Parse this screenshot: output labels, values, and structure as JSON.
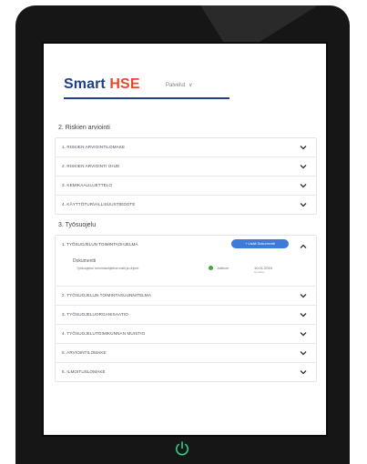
{
  "app": {
    "brand_primary": "Smart",
    "brand_accent": "HSE",
    "menu_label": "Palvelut"
  },
  "sections": [
    {
      "title": "2. Riskien arviointi",
      "items": [
        {
          "label": "1. RISKIEN ARVIOINTILOMAKE"
        },
        {
          "label": "2. RISKIEN ARVIOINTI OHJE"
        },
        {
          "label": "3. KEMIKAALILUETTELO"
        },
        {
          "label": "4. KÄYTTÖTURVALLISUUSTIEDOTE"
        }
      ]
    },
    {
      "title": "3. Työsuojelu",
      "expanded": {
        "label": "1. TYÖSUOJELUN TOIMINTAOHJELMA",
        "add_button": "+ Lisää Dokumentti",
        "documents_title": "Dokumentti",
        "document": {
          "name": "Työsuojelun toimintaohjelma malli ja ohjeet",
          "status": "Julkinen",
          "date": "10.01.2019",
          "date_sub": "Hyväksy"
        }
      },
      "items": [
        {
          "label": "2. TYÖSUOJELUN TOIMINTASUUNNITELMA"
        },
        {
          "label": "3. TYÖSUOJELUORGANISAATIO"
        },
        {
          "label": "4. TYÖSUOJELUTOIMIKUNNAN MUISTIO"
        },
        {
          "label": "5. ARVIOINTILOMAKE"
        },
        {
          "label": "6. ILMOITUSLOMAKE"
        }
      ]
    }
  ],
  "colors": {
    "brand_blue": "#1f3f8c",
    "brand_orange": "#e8482a",
    "button_blue": "#3e7bd8",
    "status_green": "#3caa3c"
  },
  "icons": {
    "row_toggle": "chevron-down-icon",
    "expanded_toggle": "chevron-up-icon",
    "power": "power-icon"
  }
}
